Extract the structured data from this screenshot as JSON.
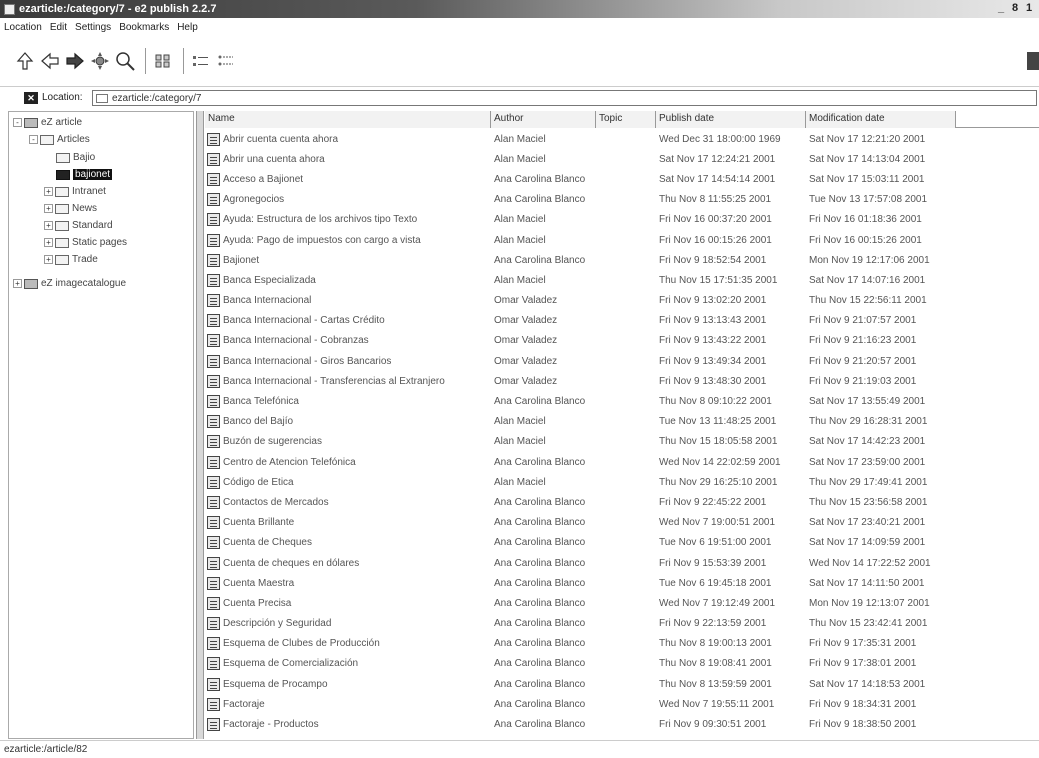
{
  "window": {
    "title": "ezarticle:/category/7 - e2 publish 2.2.7",
    "controls": [
      "_",
      "8",
      "1"
    ]
  },
  "menubar": {
    "items": [
      "Location",
      "Edit",
      "Settings",
      "Bookmarks",
      "Help"
    ]
  },
  "toolbar": {
    "buttons": [
      "up-icon",
      "back-icon",
      "forward-icon",
      "reload-icon",
      "find-icon",
      "icon-view-icon",
      "list-view-icon",
      "detail-view-icon"
    ]
  },
  "location": {
    "label": "Location:",
    "value": "ezarticle:/category/7"
  },
  "tree": {
    "items": [
      {
        "label": "eZ article",
        "expander": "-",
        "depth": 0
      },
      {
        "label": "Articles",
        "expander": "-",
        "depth": 1
      },
      {
        "label": "Bajio",
        "expander": "",
        "depth": 2
      },
      {
        "label": "bajionet",
        "expander": "",
        "depth": 2,
        "selected": true
      },
      {
        "label": "Intranet",
        "expander": "+",
        "depth": 2
      },
      {
        "label": "News",
        "expander": "+",
        "depth": 2
      },
      {
        "label": "Standard",
        "expander": "+",
        "depth": 2
      },
      {
        "label": "Static pages",
        "expander": "+",
        "depth": 2
      },
      {
        "label": "Trade",
        "expander": "+",
        "depth": 2
      },
      {
        "label": "eZ imagecatalogue",
        "expander": "+",
        "depth": 0
      }
    ]
  },
  "table": {
    "columns": [
      "Name",
      "Author",
      "Topic",
      "Publish date",
      "Modification date"
    ],
    "rows": [
      {
        "name": "Abrir cuenta cuenta ahora",
        "author": "Alan Maciel",
        "topic": "",
        "published": "Wed Dec 31 18:00:00 1969",
        "modified": "Sat Nov 17 12:21:20 2001"
      },
      {
        "name": "Abrir una cuenta ahora",
        "author": "Alan Maciel",
        "topic": "",
        "published": "Sat Nov 17 12:24:21 2001",
        "modified": "Sat Nov 17 14:13:04 2001"
      },
      {
        "name": "Acceso a Bajionet",
        "author": "Ana Carolina Blanco",
        "topic": "",
        "published": "Sat Nov 17 14:54:14 2001",
        "modified": "Sat Nov 17 15:03:11 2001"
      },
      {
        "name": "Agronegocios",
        "author": "Ana Carolina Blanco",
        "topic": "",
        "published": "Thu Nov 8 11:55:25 2001",
        "modified": "Tue Nov 13 17:57:08 2001"
      },
      {
        "name": "Ayuda: Estructura de los archivos tipo Texto",
        "author": "Alan Maciel",
        "topic": "",
        "published": "Fri Nov 16 00:37:20 2001",
        "modified": "Fri Nov 16 01:18:36 2001"
      },
      {
        "name": "Ayuda: Pago de impuestos con cargo a vista",
        "author": "Alan Maciel",
        "topic": "",
        "published": "Fri Nov 16 00:15:26 2001",
        "modified": "Fri Nov 16 00:15:26 2001"
      },
      {
        "name": "Bajionet",
        "author": "Ana Carolina Blanco",
        "topic": "",
        "published": "Fri Nov 9 18:52:54 2001",
        "modified": "Mon Nov 19 12:17:06 2001"
      },
      {
        "name": "Banca Especializada",
        "author": "Alan Maciel",
        "topic": "",
        "published": "Thu Nov 15 17:51:35 2001",
        "modified": "Sat Nov 17 14:07:16 2001"
      },
      {
        "name": "Banca Internacional",
        "author": "Omar Valadez",
        "topic": "",
        "published": "Fri Nov 9 13:02:20 2001",
        "modified": "Thu Nov 15 22:56:11 2001"
      },
      {
        "name": "Banca Internacional - Cartas Crédito",
        "author": "Omar Valadez",
        "topic": "",
        "published": "Fri Nov 9 13:13:43 2001",
        "modified": "Fri Nov 9 21:07:57 2001"
      },
      {
        "name": "Banca Internacional - Cobranzas",
        "author": "Omar Valadez",
        "topic": "",
        "published": "Fri Nov 9 13:43:22 2001",
        "modified": "Fri Nov 9 21:16:23 2001"
      },
      {
        "name": "Banca Internacional - Giros Bancarios",
        "author": "Omar Valadez",
        "topic": "",
        "published": "Fri Nov 9 13:49:34 2001",
        "modified": "Fri Nov 9 21:20:57 2001"
      },
      {
        "name": "Banca Internacional - Transferencias al Extranjero",
        "author": "Omar Valadez",
        "topic": "",
        "published": "Fri Nov 9 13:48:30 2001",
        "modified": "Fri Nov 9 21:19:03 2001"
      },
      {
        "name": "Banca Telefónica",
        "author": "Ana Carolina Blanco",
        "topic": "",
        "published": "Thu Nov 8 09:10:22 2001",
        "modified": "Sat Nov 17 13:55:49 2001"
      },
      {
        "name": "Banco del Bajío",
        "author": "Alan Maciel",
        "topic": "",
        "published": "Tue Nov 13 11:48:25 2001",
        "modified": "Thu Nov 29 16:28:31 2001"
      },
      {
        "name": "Buzón de sugerencias",
        "author": "Alan Maciel",
        "topic": "",
        "published": "Thu Nov 15 18:05:58 2001",
        "modified": "Sat Nov 17 14:42:23 2001"
      },
      {
        "name": "Centro de Atencion Telefónica",
        "author": "Ana Carolina Blanco",
        "topic": "",
        "published": "Wed Nov 14 22:02:59 2001",
        "modified": "Sat Nov 17 23:59:00 2001"
      },
      {
        "name": "Código de Etica",
        "author": "Alan Maciel",
        "topic": "",
        "published": "Thu Nov 29 16:25:10 2001",
        "modified": "Thu Nov 29 17:49:41 2001"
      },
      {
        "name": "Contactos de Mercados",
        "author": "Ana Carolina Blanco",
        "topic": "",
        "published": "Fri Nov 9 22:45:22 2001",
        "modified": "Thu Nov 15 23:56:58 2001"
      },
      {
        "name": "Cuenta Brillante",
        "author": "Ana Carolina Blanco",
        "topic": "",
        "published": "Wed Nov 7 19:00:51 2001",
        "modified": "Sat Nov 17 23:40:21 2001"
      },
      {
        "name": "Cuenta de Cheques",
        "author": "Ana Carolina Blanco",
        "topic": "",
        "published": "Tue Nov 6 19:51:00 2001",
        "modified": "Sat Nov 17 14:09:59 2001"
      },
      {
        "name": "Cuenta de cheques en dólares",
        "author": "Ana Carolina Blanco",
        "topic": "",
        "published": "Fri Nov 9 15:53:39 2001",
        "modified": "Wed Nov 14 17:22:52 2001"
      },
      {
        "name": "Cuenta Maestra",
        "author": "Ana Carolina Blanco",
        "topic": "",
        "published": "Tue Nov 6 19:45:18 2001",
        "modified": "Sat Nov 17 14:11:50 2001"
      },
      {
        "name": "Cuenta Precisa",
        "author": "Ana Carolina Blanco",
        "topic": "",
        "published": "Wed Nov 7 19:12:49 2001",
        "modified": "Mon Nov 19 12:13:07 2001"
      },
      {
        "name": "Descripción y Seguridad",
        "author": "Ana Carolina Blanco",
        "topic": "",
        "published": "Fri Nov 9 22:13:59 2001",
        "modified": "Thu Nov 15 23:42:41 2001"
      },
      {
        "name": "Esquema de Clubes de Producción",
        "author": "Ana Carolina Blanco",
        "topic": "",
        "published": "Thu Nov 8 19:00:13 2001",
        "modified": "Fri Nov 9 17:35:31 2001"
      },
      {
        "name": "Esquema de Comercialización",
        "author": "Ana Carolina Blanco",
        "topic": "",
        "published": "Thu Nov 8 19:08:41 2001",
        "modified": "Fri Nov 9 17:38:01 2001"
      },
      {
        "name": "Esquema de Procampo",
        "author": "Ana Carolina Blanco",
        "topic": "",
        "published": "Thu Nov 8 13:59:59 2001",
        "modified": "Sat Nov 17 14:18:53 2001"
      },
      {
        "name": "Factoraje",
        "author": "Ana Carolina Blanco",
        "topic": "",
        "published": "Wed Nov 7 19:55:11 2001",
        "modified": "Fri Nov 9 18:34:31 2001"
      },
      {
        "name": "Factoraje - Productos",
        "author": "Ana Carolina Blanco",
        "topic": "",
        "published": "Fri Nov 9 09:30:51 2001",
        "modified": "Fri Nov 9 18:38:50 2001"
      }
    ]
  },
  "status": {
    "text": "ezarticle:/article/82"
  }
}
